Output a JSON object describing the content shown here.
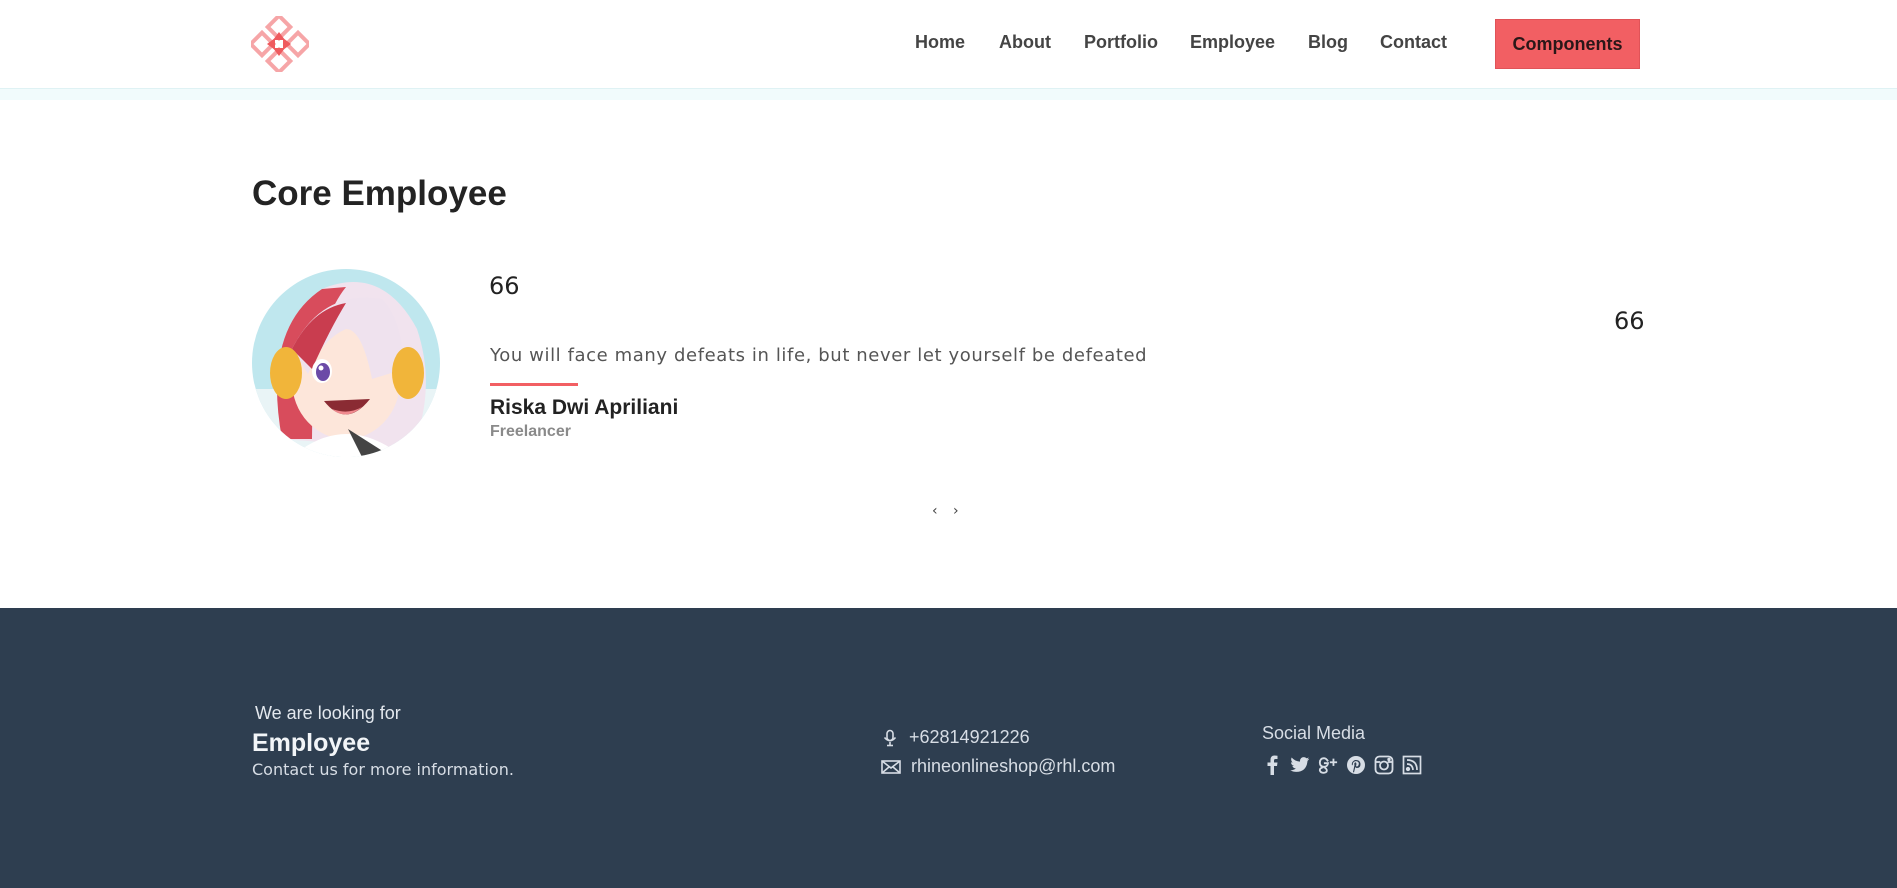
{
  "header": {
    "nav": [
      {
        "label": "Home"
      },
      {
        "label": "About"
      },
      {
        "label": "Portfolio"
      },
      {
        "label": "Employee"
      },
      {
        "label": "Blog"
      },
      {
        "label": "Contact"
      }
    ],
    "cta_label": "Components",
    "logo_icon": "diamond-arrows-logo"
  },
  "main": {
    "title": "Core Employee",
    "testimonial": {
      "quote_open": "66",
      "quote_close": "66",
      "text": "You will face many defeats in life, but never let yourself be defeated",
      "name": "Riska Dwi Apriliani",
      "role": "Freelancer"
    },
    "pager": {
      "prev": "‹",
      "next": "›"
    }
  },
  "footer": {
    "looking_for": "We are looking for",
    "position": "Employee",
    "cta_text": "Contact us for more information.",
    "phone": "+62814921226",
    "email": "rhineonlineshop@rhl.com",
    "social_title": "Social Media",
    "social_icons": [
      "facebook-icon",
      "twitter-icon",
      "google-plus-icon",
      "pinterest-icon",
      "instagram-icon",
      "rss-icon"
    ]
  },
  "colors": {
    "accent": "#f25f63",
    "footer_bg": "#2e3e50"
  }
}
